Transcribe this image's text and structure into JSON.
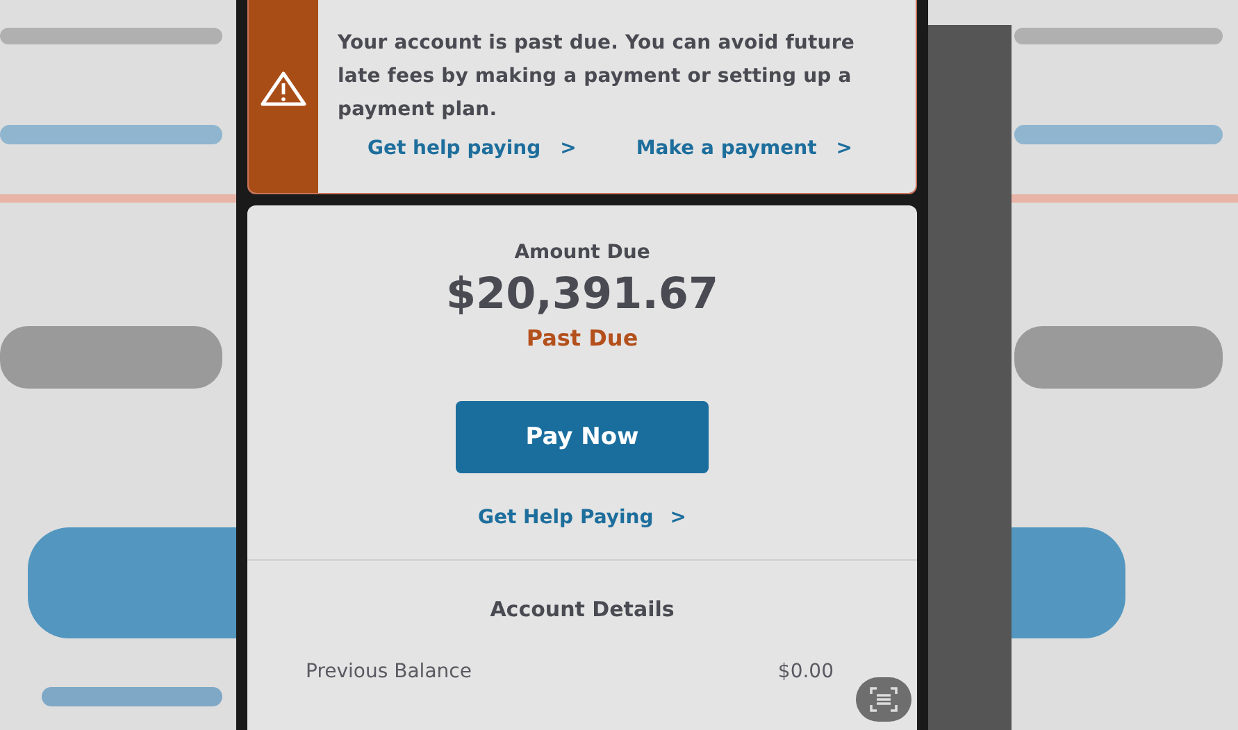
{
  "alert": {
    "message": "Your account is past due. You can avoid future late fees by making a payment or setting up a payment plan.",
    "links": [
      {
        "label": "Get help paying",
        "chevron": ">"
      },
      {
        "label": "Make a payment",
        "chevron": ">"
      }
    ]
  },
  "summary": {
    "label": "Amount Due",
    "amount": "$20,391.67",
    "status": "Past Due",
    "pay_button": "Pay Now",
    "help_link": {
      "label": "Get Help Paying",
      "chevron": ">"
    }
  },
  "account_details": {
    "title": "Account Details",
    "rows": [
      {
        "label": "Previous Balance",
        "value": "$0.00"
      }
    ]
  }
}
